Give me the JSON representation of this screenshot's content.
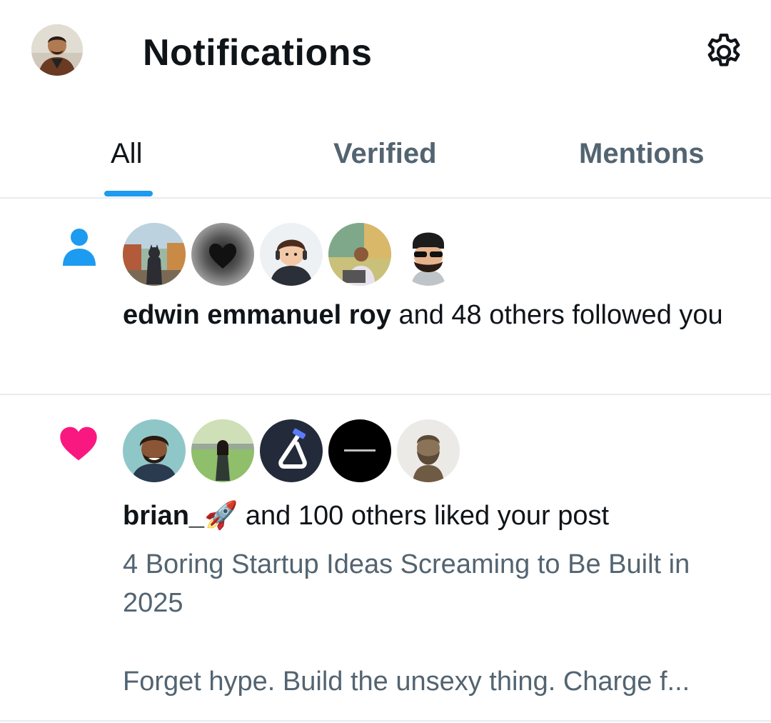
{
  "header": {
    "title": "Notifications",
    "icons": {
      "avatar": "profile-avatar",
      "settings": "gear-icon"
    }
  },
  "tabs": [
    {
      "label": "All",
      "active": true
    },
    {
      "label": "Verified",
      "active": false
    },
    {
      "label": "Mentions",
      "active": false
    }
  ],
  "colors": {
    "accent": "#1d9bf0",
    "like": "#f91880",
    "secondary_text": "#536471",
    "divider": "#e7ecef"
  },
  "notifications": [
    {
      "type": "follow",
      "icon": "person-icon",
      "actor": "edwin emmanuel roy",
      "rest": " and 48 others followed you"
    },
    {
      "type": "like",
      "icon": "heart-icon",
      "actor": "brian_🚀",
      "rest": " and 100 others liked your post",
      "post_title_line1": "4 Boring Startup Ideas Screaming to Be Built in",
      "post_title_line2": "2025",
      "post_excerpt": "Forget hype. Build the unsexy thing. Charge f..."
    }
  ]
}
